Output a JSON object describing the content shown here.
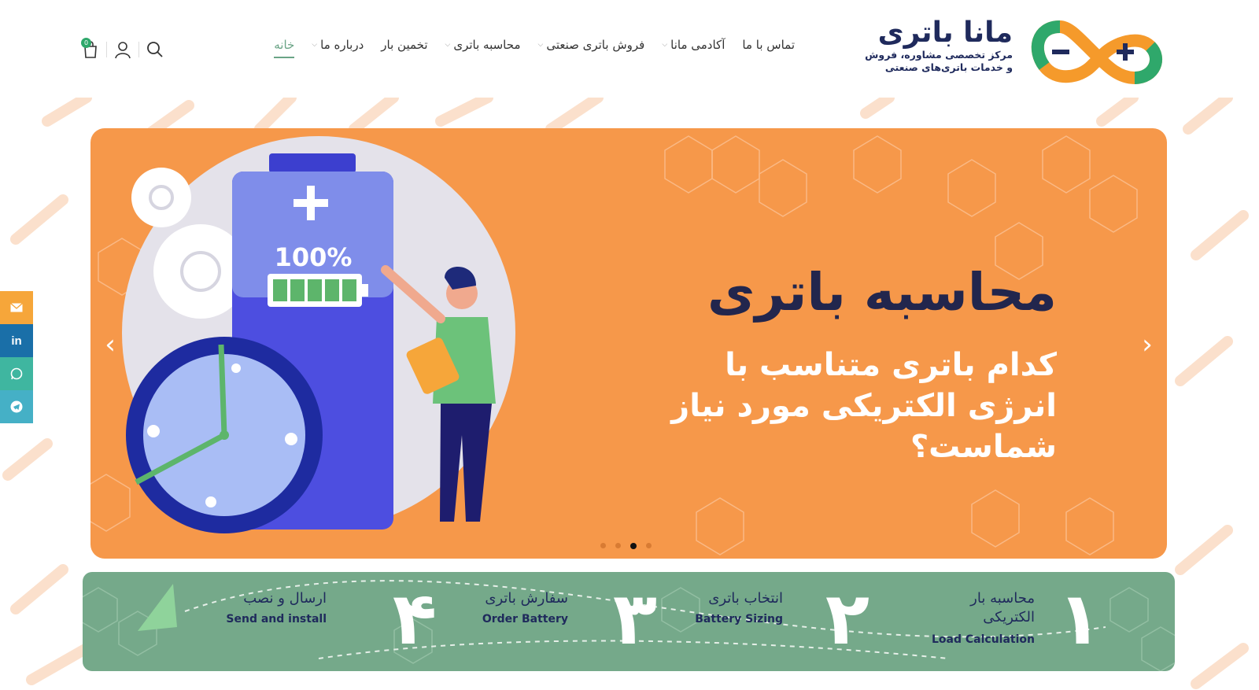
{
  "brand": {
    "title": "مانا باتری",
    "subtitle_line1": "مرکز تخصصی مشاوره، فروش",
    "subtitle_line2": "و خدمات باتری‌های صنعتی",
    "colors": {
      "navy": "#1f2a5c",
      "green": "#6aa486",
      "orange": "#f6984a"
    }
  },
  "nav": {
    "items": [
      {
        "label": "خانه",
        "active": true,
        "dropdown": false
      },
      {
        "label": "درباره ما",
        "active": false,
        "dropdown": true
      },
      {
        "label": "تخمین بار",
        "active": false,
        "dropdown": false
      },
      {
        "label": "محاسبه باتری",
        "active": false,
        "dropdown": true
      },
      {
        "label": "فروش باتری صنعتی",
        "active": false,
        "dropdown": true
      },
      {
        "label": "آکادمی مانا",
        "active": false,
        "dropdown": true
      },
      {
        "label": "تماس با ما",
        "active": false,
        "dropdown": false
      }
    ]
  },
  "tools": {
    "search_icon": "search-icon",
    "account_icon": "user-icon",
    "cart_icon": "cart-icon",
    "cart_count": "0"
  },
  "slider": {
    "title": "محاسبه باتری",
    "subtitle": "کدام باتری متناسب با انرژی الکتریکی مورد نیاز شماست؟",
    "battery_label": "100%",
    "battery_level": 1.0,
    "active_slide": 3,
    "slide_count": 4
  },
  "steps": [
    {
      "number": "۱",
      "fa": "محاسبه بار الکتریکی",
      "en": "Load Calculation"
    },
    {
      "number": "۲",
      "fa": "انتخاب باتری",
      "en": "Battery Sizing"
    },
    {
      "number": "۳",
      "fa": "سفارش باتری",
      "en": "Order Battery"
    },
    {
      "number": "۴",
      "fa": "ارسال و نصب",
      "en": "Send and install"
    }
  ],
  "social": [
    {
      "name": "email",
      "color": "#f6a63a"
    },
    {
      "name": "linkedin",
      "color": "#1a6fa8"
    },
    {
      "name": "whatsapp",
      "color": "#3fb6a0"
    },
    {
      "name": "telegram",
      "color": "#45b0c6"
    }
  ]
}
